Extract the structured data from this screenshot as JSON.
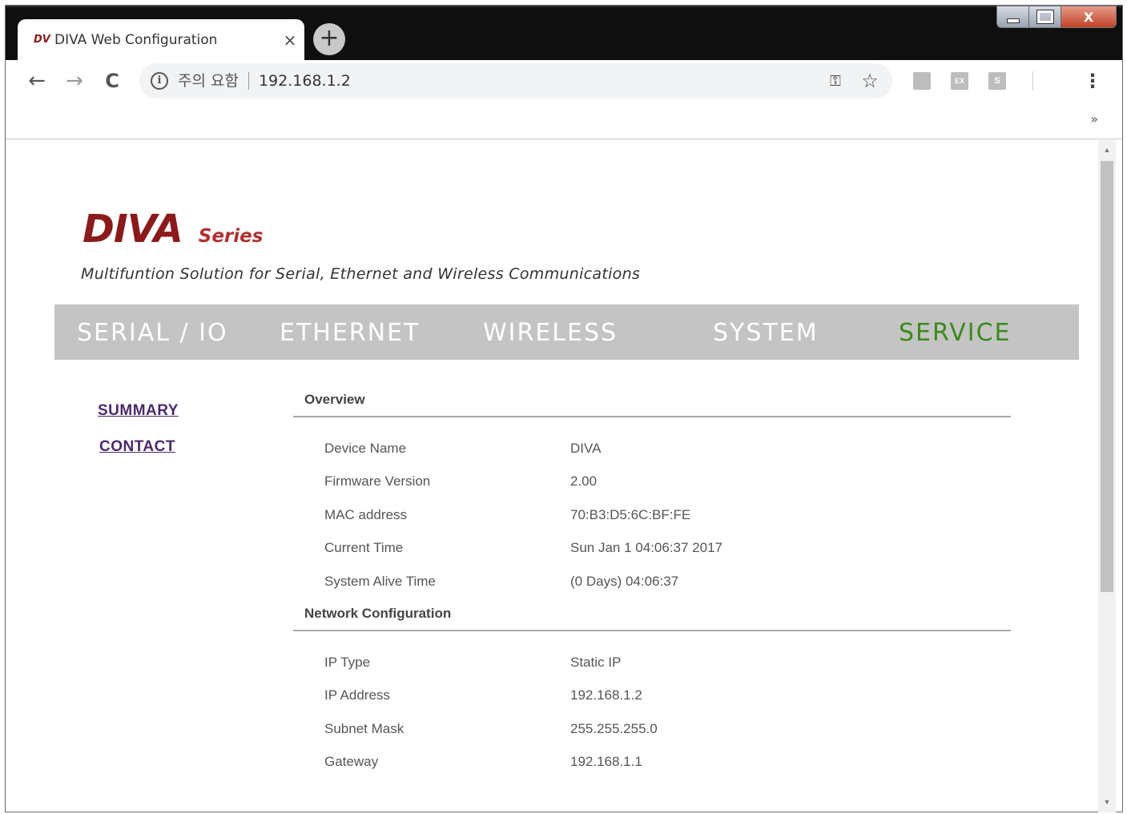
{
  "browser": {
    "tab": {
      "favicon": "DV",
      "title": "DIVA Web Configuration",
      "close": "×"
    },
    "new_tab": "+",
    "window_controls": {
      "close": "X"
    },
    "nav": {
      "back": "←",
      "forward": "→",
      "reload": "C"
    },
    "omnibox": {
      "info_icon": "i",
      "security_text": "주의 요함",
      "url": "192.168.1.2"
    },
    "icons": {
      "key": "key-icon",
      "star": "star-icon",
      "menu": "menu-icon"
    },
    "extensions": [
      "",
      "EX",
      "S"
    ],
    "bookmarks_overflow": "»"
  },
  "page": {
    "logo": {
      "main": "DIVA",
      "sub": "Series"
    },
    "tagline": "Multifuntion Solution for Serial, Ethernet and Wireless Communications",
    "nav": {
      "items": [
        "SERIAL / IO",
        "ETHERNET",
        "WIRELESS",
        "SYSTEM",
        "SERVICE"
      ],
      "active": "SERVICE"
    },
    "sidebar": {
      "links": [
        "SUMMARY",
        "CONTACT"
      ]
    },
    "overview": {
      "title": "Overview",
      "rows": [
        {
          "label": "Device Name",
          "value": "DIVA"
        },
        {
          "label": "Firmware Version",
          "value": "2.00"
        },
        {
          "label": "MAC address",
          "value": "70:B3:D5:6C:BF:FE"
        },
        {
          "label": "Current Time",
          "value": "Sun Jan 1 04:06:37 2017"
        },
        {
          "label": "System Alive Time",
          "value": "(0 Days) 04:06:37"
        }
      ]
    },
    "network": {
      "title": "Network Configuration",
      "rows": [
        {
          "label": "IP Type",
          "value": "Static IP"
        },
        {
          "label": "IP Address",
          "value": "192.168.1.2"
        },
        {
          "label": "Subnet Mask",
          "value": "255.255.255.0"
        },
        {
          "label": "Gateway",
          "value": "192.168.1.1"
        }
      ]
    }
  },
  "colors": {
    "logo": "#8b1a1a",
    "nav_bg": "#c4c4c4",
    "nav_text": "#ffffff",
    "nav_active": "#3a8a1a",
    "side_link": "#4a2a6a"
  }
}
